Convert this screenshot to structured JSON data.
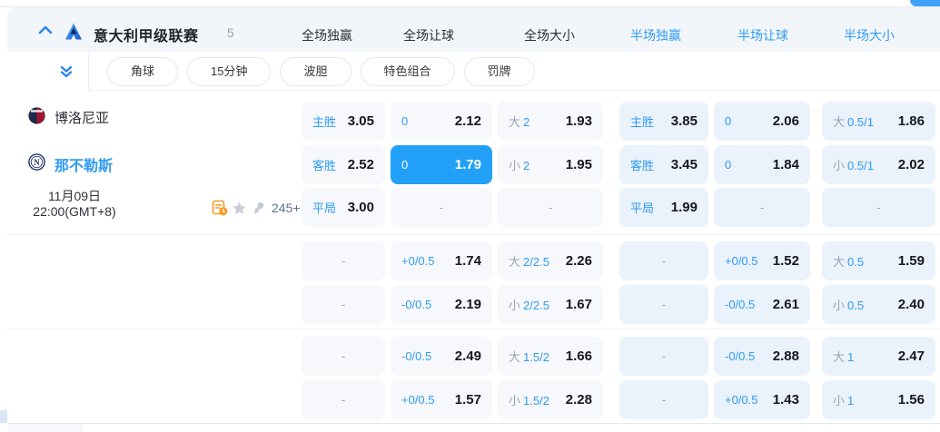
{
  "header": {
    "league_name": "意大利甲级联赛",
    "match_count": "5",
    "collapse_icon": "chevron-up-icon",
    "tabs": [
      {
        "label": "全场独赢",
        "style": "dark"
      },
      {
        "label": "全场让球",
        "style": "dark"
      },
      {
        "label": "全场大小",
        "style": "dark"
      },
      {
        "label": "半场独赢",
        "style": "blue"
      },
      {
        "label": "半场让球",
        "style": "blue"
      },
      {
        "label": "半场大小",
        "style": "blue"
      }
    ]
  },
  "filters": {
    "expand_icon": "double-chevron-down-icon",
    "pills": [
      "角球",
      "15分钟",
      "波胆",
      "特色组合",
      "罚牌"
    ]
  },
  "match": {
    "home_team": "博洛尼亚",
    "away_team": "那不勒斯",
    "date": "11月09日",
    "time": "22:00(GMT+8)",
    "extra_markets": "245+",
    "meta_icons": [
      "match-stats-icon",
      "star-icon",
      "pin-icon"
    ]
  },
  "colors": {
    "accent_blue": "#2e9bf5",
    "highlight_cell": "#22a0f7",
    "full_cell_bg": "#f6f8fb",
    "half_cell_bg": "#eaf2fc",
    "orange_icon": "#f59b25"
  },
  "odds_blocks": [
    {
      "rows": [
        [
          {
            "label": "主胜",
            "value": "3.05"
          },
          {
            "label": "0",
            "value": "2.12"
          },
          {
            "pre": "大",
            "label": "2",
            "value": "1.93"
          },
          {
            "label": "主胜",
            "value": "3.85"
          },
          {
            "label": "0",
            "value": "2.06"
          },
          {
            "pre": "大",
            "label": "0.5/1",
            "value": "1.86"
          }
        ],
        [
          {
            "label": "客胜",
            "value": "2.52"
          },
          {
            "label": "0",
            "value": "1.79",
            "highlight": true
          },
          {
            "pre": "小",
            "label": "2",
            "value": "1.95"
          },
          {
            "label": "客胜",
            "value": "3.45"
          },
          {
            "label": "0",
            "value": "1.84"
          },
          {
            "pre": "小",
            "label": "0.5/1",
            "value": "2.02"
          }
        ],
        [
          {
            "label": "平局",
            "value": "3.00"
          },
          {
            "dash": true
          },
          {
            "dash": true
          },
          {
            "label": "平局",
            "value": "1.99"
          },
          {
            "dash": true
          },
          {
            "dash": true
          }
        ]
      ]
    },
    {
      "rows": [
        [
          {
            "dash": true
          },
          {
            "label": "+0/0.5",
            "value": "1.74"
          },
          {
            "pre": "大",
            "label": "2/2.5",
            "value": "2.26"
          },
          {
            "dash": true
          },
          {
            "label": "+0/0.5",
            "value": "1.52"
          },
          {
            "pre": "大",
            "label": "0.5",
            "value": "1.59"
          }
        ],
        [
          {
            "dash": true
          },
          {
            "label": "-0/0.5",
            "value": "2.19"
          },
          {
            "pre": "小",
            "label": "2/2.5",
            "value": "1.67"
          },
          {
            "dash": true
          },
          {
            "label": "-0/0.5",
            "value": "2.61"
          },
          {
            "pre": "小",
            "label": "0.5",
            "value": "2.40"
          }
        ]
      ]
    },
    {
      "rows": [
        [
          {
            "dash": true
          },
          {
            "label": "-0/0.5",
            "value": "2.49"
          },
          {
            "pre": "大",
            "label": "1.5/2",
            "value": "1.66"
          },
          {
            "dash": true
          },
          {
            "label": "-0/0.5",
            "value": "2.88"
          },
          {
            "pre": "大",
            "label": "1",
            "value": "2.47"
          }
        ],
        [
          {
            "dash": true
          },
          {
            "label": "+0/0.5",
            "value": "1.57"
          },
          {
            "pre": "小",
            "label": "1.5/2",
            "value": "2.28"
          },
          {
            "dash": true
          },
          {
            "label": "+0/0.5",
            "value": "1.43"
          },
          {
            "pre": "小",
            "label": "1",
            "value": "1.56"
          }
        ]
      ]
    }
  ]
}
